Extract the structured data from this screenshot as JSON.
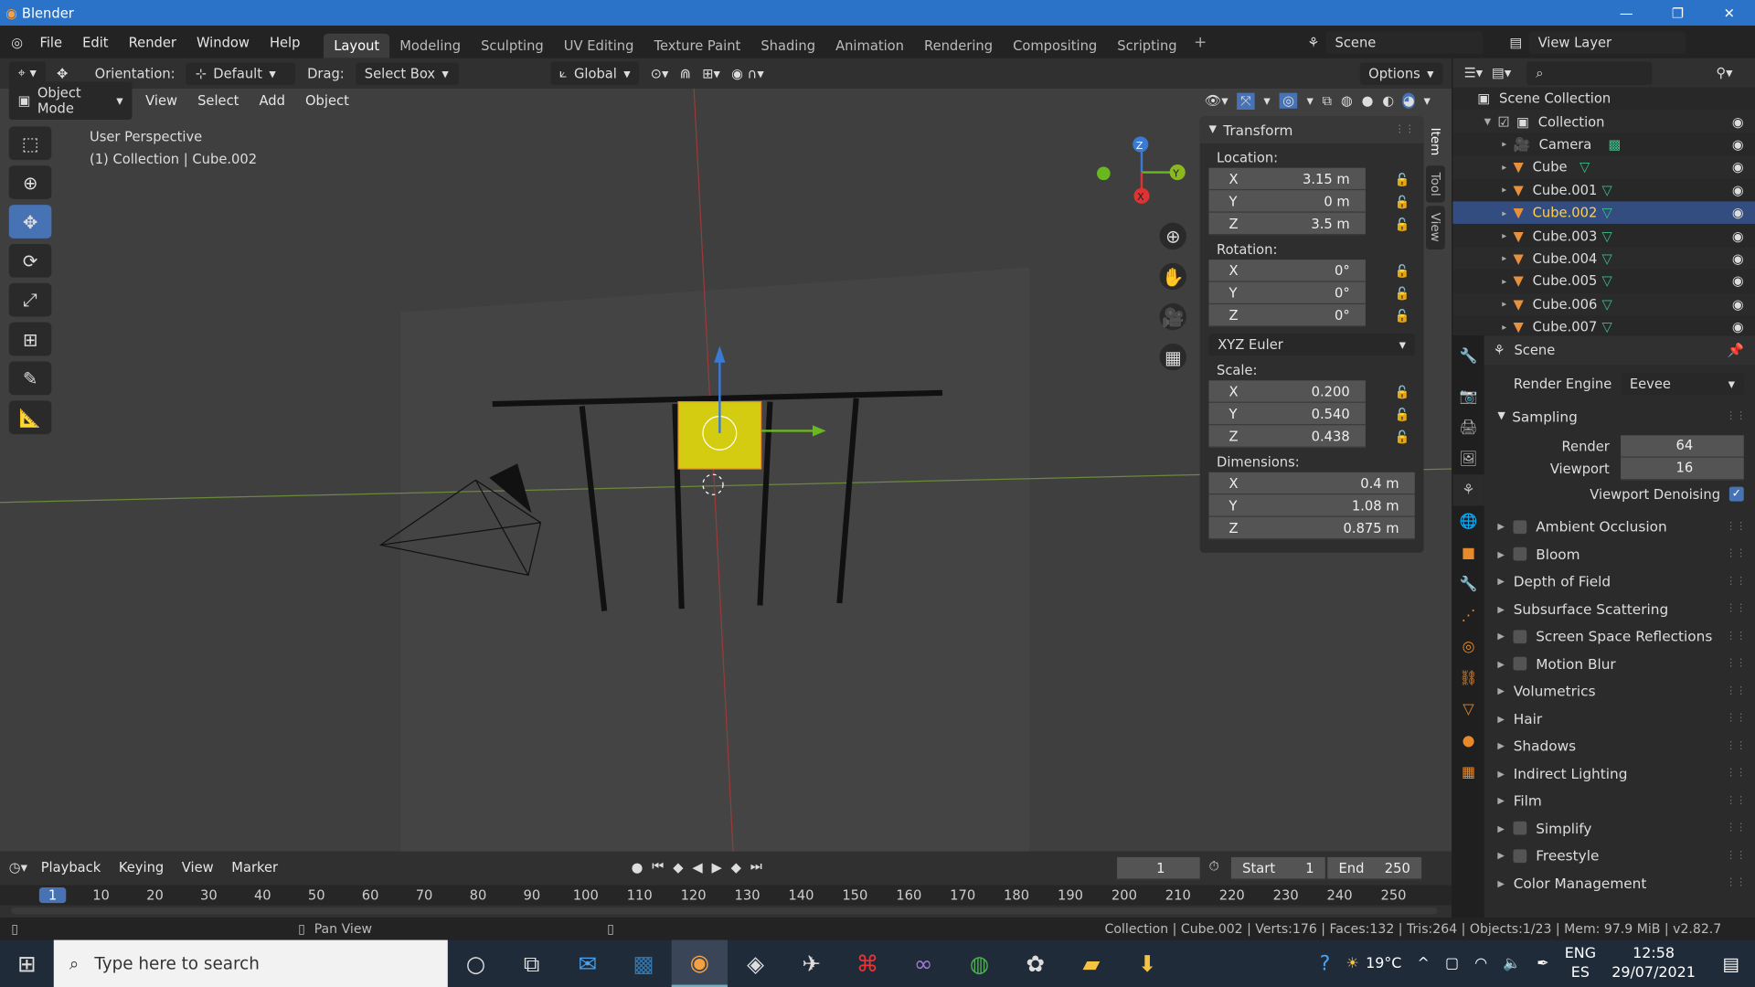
{
  "window": {
    "title": "Blender"
  },
  "menus": [
    "File",
    "Edit",
    "Render",
    "Window",
    "Help"
  ],
  "workspaces": [
    "Layout",
    "Modeling",
    "Sculpting",
    "UV Editing",
    "Texture Paint",
    "Shading",
    "Animation",
    "Rendering",
    "Compositing",
    "Scripting"
  ],
  "active_workspace": "Layout",
  "scene_selector": "Scene",
  "view_layer": "View Layer",
  "header": {
    "orientation_label": "Orientation:",
    "orientation_value": "Default",
    "drag_label": "Drag:",
    "drag_value": "Select Box",
    "transform_space": "Global",
    "options": "Options"
  },
  "viewport_header": {
    "mode": "Object Mode",
    "menus": [
      "View",
      "Select",
      "Add",
      "Object"
    ]
  },
  "viewport": {
    "perspective": "User Perspective",
    "context": "(1) Collection | Cube.002"
  },
  "npanel": {
    "tabs": [
      "Item",
      "Tool",
      "View"
    ],
    "title": "Transform",
    "location_label": "Location:",
    "location": [
      [
        "X",
        "3.15 m"
      ],
      [
        "Y",
        "0 m"
      ],
      [
        "Z",
        "3.5 m"
      ]
    ],
    "rotation_label": "Rotation:",
    "rotation": [
      [
        "X",
        "0°"
      ],
      [
        "Y",
        "0°"
      ],
      [
        "Z",
        "0°"
      ]
    ],
    "rotation_mode": "XYZ Euler",
    "scale_label": "Scale:",
    "scale": [
      [
        "X",
        "0.200"
      ],
      [
        "Y",
        "0.540"
      ],
      [
        "Z",
        "0.438"
      ]
    ],
    "dimensions_label": "Dimensions:",
    "dimensions": [
      [
        "X",
        "0.4 m"
      ],
      [
        "Y",
        "1.08 m"
      ],
      [
        "Z",
        "0.875 m"
      ]
    ]
  },
  "outliner": {
    "root": "Scene Collection",
    "items": [
      {
        "name": "Collection",
        "type": "collection"
      },
      {
        "name": "Camera",
        "type": "camera"
      },
      {
        "name": "Cube",
        "type": "mesh"
      },
      {
        "name": "Cube.001",
        "type": "mesh"
      },
      {
        "name": "Cube.002",
        "type": "mesh",
        "selected": true
      },
      {
        "name": "Cube.003",
        "type": "mesh"
      },
      {
        "name": "Cube.004",
        "type": "mesh"
      },
      {
        "name": "Cube.005",
        "type": "mesh"
      },
      {
        "name": "Cube.006",
        "type": "mesh"
      },
      {
        "name": "Cube.007",
        "type": "mesh"
      }
    ]
  },
  "properties": {
    "context": "Scene",
    "render_engine_label": "Render Engine",
    "render_engine": "Eevee",
    "sampling": "Sampling",
    "render_label": "Render",
    "render_samples": "64",
    "viewport_label": "Viewport",
    "viewport_samples": "16",
    "denoise_label": "Viewport Denoising",
    "denoise": true,
    "sections": [
      {
        "label": "Ambient Occlusion",
        "checkbox": true
      },
      {
        "label": "Bloom",
        "checkbox": true
      },
      {
        "label": "Depth of Field",
        "checkbox": false
      },
      {
        "label": "Subsurface Scattering",
        "checkbox": false
      },
      {
        "label": "Screen Space Reflections",
        "checkbox": true
      },
      {
        "label": "Motion Blur",
        "checkbox": true
      },
      {
        "label": "Volumetrics",
        "checkbox": false
      },
      {
        "label": "Hair",
        "checkbox": false
      },
      {
        "label": "Shadows",
        "checkbox": false
      },
      {
        "label": "Indirect Lighting",
        "checkbox": false
      },
      {
        "label": "Film",
        "checkbox": false
      },
      {
        "label": "Simplify",
        "checkbox": true
      },
      {
        "label": "Freestyle",
        "checkbox": true
      },
      {
        "label": "Color Management",
        "checkbox": false
      }
    ]
  },
  "timeline": {
    "menus": [
      "Playback",
      "Keying",
      "View",
      "Marker"
    ],
    "current_frame": "1",
    "start_label": "Start",
    "start": "1",
    "end_label": "End",
    "end": "250",
    "ticks": [
      "1",
      "10",
      "20",
      "30",
      "40",
      "50",
      "60",
      "70",
      "80",
      "90",
      "100",
      "110",
      "120",
      "130",
      "140",
      "150",
      "160",
      "170",
      "180",
      "190",
      "200",
      "210",
      "220",
      "230",
      "240",
      "250"
    ]
  },
  "status": {
    "hint": "Pan View",
    "stats": "Collection | Cube.002 | Verts:176 | Faces:132 | Tris:264 | Objects:1/23 | Mem: 97.9 MiB | v2.82.7"
  },
  "taskbar": {
    "search_placeholder": "Type here to search",
    "weather": "19°C",
    "lang1": "ENG",
    "lang2": "ES",
    "time": "12:58",
    "date": "29/07/2021"
  },
  "colors": {
    "accent": "#4772b3",
    "selected_text": "#ffcf56",
    "object_orange": "#e8903c",
    "mesh_green": "#3bbf8a",
    "titlebar": "#2a73c8"
  }
}
